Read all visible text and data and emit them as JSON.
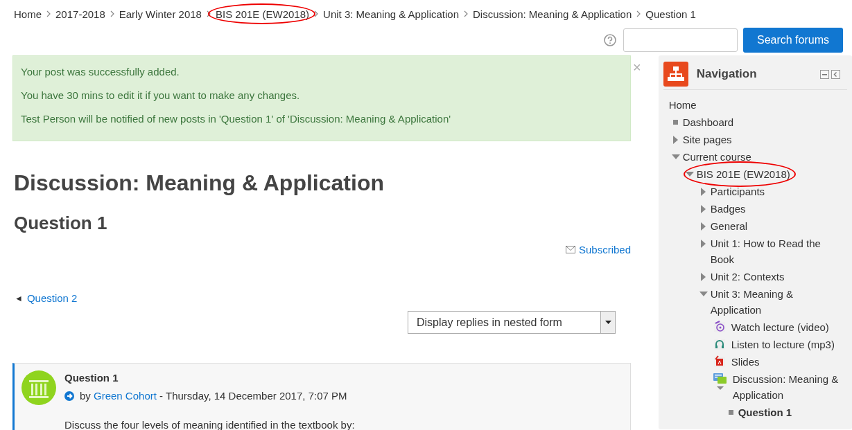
{
  "breadcrumb": [
    {
      "label": "Home",
      "highlighted": false
    },
    {
      "label": "2017-2018",
      "highlighted": false
    },
    {
      "label": "Early Winter 2018",
      "highlighted": false
    },
    {
      "label": "BIS 201E (EW2018)",
      "highlighted": true
    },
    {
      "label": "Unit 3: Meaning & Application",
      "highlighted": false
    },
    {
      "label": "Discussion: Meaning & Application",
      "highlighted": false
    },
    {
      "label": "Question 1",
      "highlighted": false
    }
  ],
  "search": {
    "button": "Search forums"
  },
  "alert": {
    "messages": [
      "Your post was successfully added.",
      "You have 30 mins to edit it if you want to make any changes.",
      "Test Person will be notified of new posts in 'Question 1' of 'Discussion: Meaning & Application'"
    ],
    "close": "×"
  },
  "discussion_title": "Discussion: Meaning & Application",
  "post_title": "Question 1",
  "subscription": {
    "label": "Subscribed"
  },
  "previous_link": {
    "arrow": "◄",
    "label": "Question 2"
  },
  "display_mode": {
    "value": "Display replies in nested form"
  },
  "post": {
    "subject": "Question 1",
    "by": "by",
    "author": "Green Cohort",
    "date": " - Thursday, 14 December 2017, 7:07 PM",
    "body": "Discuss the four levels of meaning identified in the textbook by:"
  },
  "navigation": {
    "title": "Navigation",
    "items": [
      {
        "label": "Home",
        "kind": "root",
        "children": [
          {
            "label": "Dashboard",
            "kind": "page",
            "current": false
          },
          {
            "label": "Site pages",
            "kind": "branch",
            "expanded": false
          },
          {
            "label": "Current course",
            "kind": "branch",
            "expanded": true,
            "children": [
              {
                "label": "BIS 201E (EW2018)",
                "kind": "branch",
                "expanded": true,
                "highlighted": true,
                "children": [
                  {
                    "label": "Participants",
                    "kind": "branch",
                    "expanded": false
                  },
                  {
                    "label": "Badges",
                    "kind": "branch",
                    "expanded": false
                  },
                  {
                    "label": "General",
                    "kind": "branch",
                    "expanded": false
                  },
                  {
                    "label": "Unit 1: How to Read the Book",
                    "kind": "branch",
                    "expanded": false
                  },
                  {
                    "label": "Unit 2: Contexts",
                    "kind": "branch",
                    "expanded": false
                  },
                  {
                    "label": "Unit 3: Meaning & Application",
                    "kind": "branch",
                    "expanded": true,
                    "children": [
                      {
                        "label": "Watch lecture (video)",
                        "kind": "video"
                      },
                      {
                        "label": "Listen to lecture (mp3)",
                        "kind": "audio"
                      },
                      {
                        "label": "Slides",
                        "kind": "pdf"
                      },
                      {
                        "label": "Discussion: Meaning & Application",
                        "kind": "forum",
                        "expanded": true,
                        "children": [
                          {
                            "label": "Question 1",
                            "kind": "page",
                            "current": true
                          }
                        ]
                      }
                    ]
                  }
                ]
              }
            ]
          }
        ]
      }
    ]
  }
}
